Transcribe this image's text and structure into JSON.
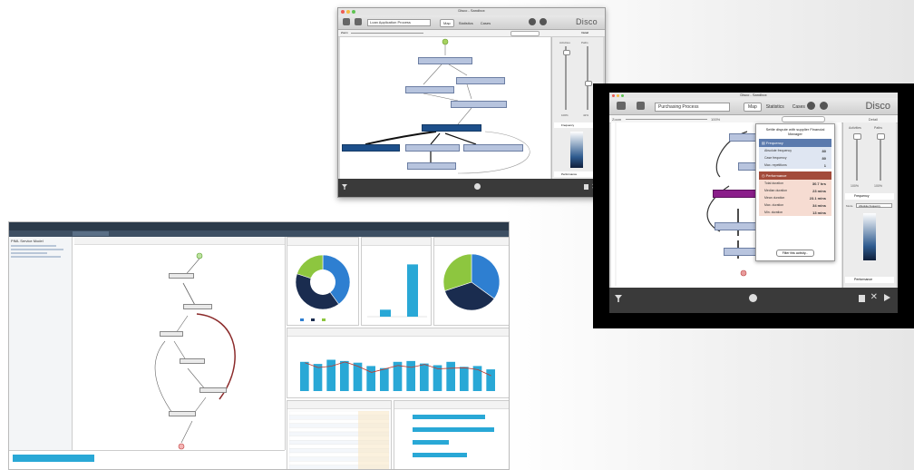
{
  "screenshot1": {
    "window_title": "Disco - Sandbox",
    "project_field": "Loan Application Process",
    "tabs": [
      "Map",
      "Statistics",
      "Cases"
    ],
    "active_tab": "Map",
    "brand": "Disco",
    "labels": {
      "zoom": "Zoom",
      "detail": "Detail",
      "activities": "Activities",
      "paths": "Paths",
      "frequency": "Frequency",
      "performance": "Performance"
    },
    "percent_activities": "100%",
    "percent_paths": "42%"
  },
  "screenshot2": {
    "window_title": "Disco - Sandbox",
    "project_field": "Purchasing Process",
    "tabs": [
      "Map",
      "Statistics",
      "Cases"
    ],
    "active_tab": "Map",
    "brand": "Disco",
    "labels": {
      "zoom": "Zoom",
      "detail": "Detail",
      "activities": "Activities",
      "paths": "Paths",
      "frequency": "Frequency",
      "performance": "Performance",
      "mode": "Mode",
      "mode_value": "Absolute frequency"
    },
    "zoom_pct": "100%",
    "percent_activities": "100%",
    "percent_paths": "100%",
    "popup": {
      "title": "Settle dispute with supplier Financial Manager",
      "frequency_header": "Frequency",
      "frequency_rows": [
        {
          "label": "Absolute frequency",
          "value": "80"
        },
        {
          "label": "Case frequency",
          "value": "80"
        },
        {
          "label": "Max. repetitions",
          "value": "1"
        }
      ],
      "performance_header": "Performance",
      "performance_rows": [
        {
          "label": "Total duration",
          "value": "30.7 hrs"
        },
        {
          "label": "Median duration",
          "value": "23 mins"
        },
        {
          "label": "Mean duration",
          "value": "23.1 mins"
        },
        {
          "label": "Max. duration",
          "value": "34 mins"
        },
        {
          "label": "Min. duration",
          "value": "13 mins"
        }
      ],
      "filter_button": "Filter this activity..."
    }
  },
  "screenshot3": {
    "left_panel_title": "PIML Service Model",
    "colors": {
      "blue": "#2e7fd1",
      "navy": "#1a2c4f",
      "green": "#8dc63f",
      "teal": "#29a8d6"
    }
  },
  "chart_data": [
    {
      "type": "pie",
      "values": [
        40,
        40,
        20
      ],
      "colors": [
        "#2e7fd1",
        "#1a2c4f",
        "#8dc63f"
      ],
      "donut": true
    },
    {
      "type": "bar",
      "values": [
        12,
        90
      ],
      "colors": [
        "#29a8d6",
        "#29a8d6"
      ]
    },
    {
      "type": "pie",
      "values": [
        35,
        35,
        30
      ],
      "colors": [
        "#2e7fd1",
        "#1a2c4f",
        "#8dc63f"
      ],
      "donut": false
    },
    {
      "type": "bar",
      "values": [
        70,
        65,
        75,
        72,
        68,
        60,
        55,
        70,
        72,
        66,
        62,
        70,
        58,
        60,
        52
      ],
      "colors": [
        "#29a8d6"
      ]
    },
    {
      "type": "bar",
      "values": [
        80,
        90,
        40,
        60
      ],
      "colors": [
        "#29a8d6"
      ]
    }
  ]
}
